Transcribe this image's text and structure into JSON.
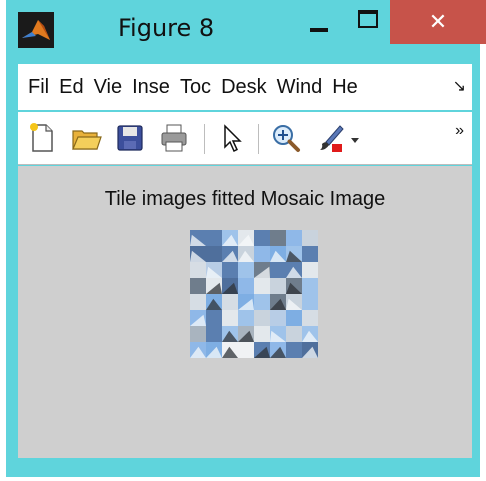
{
  "window": {
    "title": "Figure 8",
    "close_glyph": "✕"
  },
  "menu": {
    "items": [
      "Fil",
      "Ed",
      "Vie",
      "Inse",
      "Toc",
      "Desk",
      "Wind",
      "He"
    ],
    "more_glyph": "↘"
  },
  "toolbar": {
    "icons": [
      "new-file-icon",
      "open-folder-icon",
      "save-icon",
      "print-icon",
      "pointer-icon",
      "zoom-in-icon",
      "brush-icon",
      "dropdown-icon"
    ],
    "more_glyph": "»"
  },
  "figure": {
    "title": "Tile images fitted Mosaic Image"
  },
  "colors": {
    "window_frame": "#5fd4dc",
    "close_button": "#c7534a",
    "canvas": "#cfcfcf",
    "menubar": "#ffffff"
  }
}
